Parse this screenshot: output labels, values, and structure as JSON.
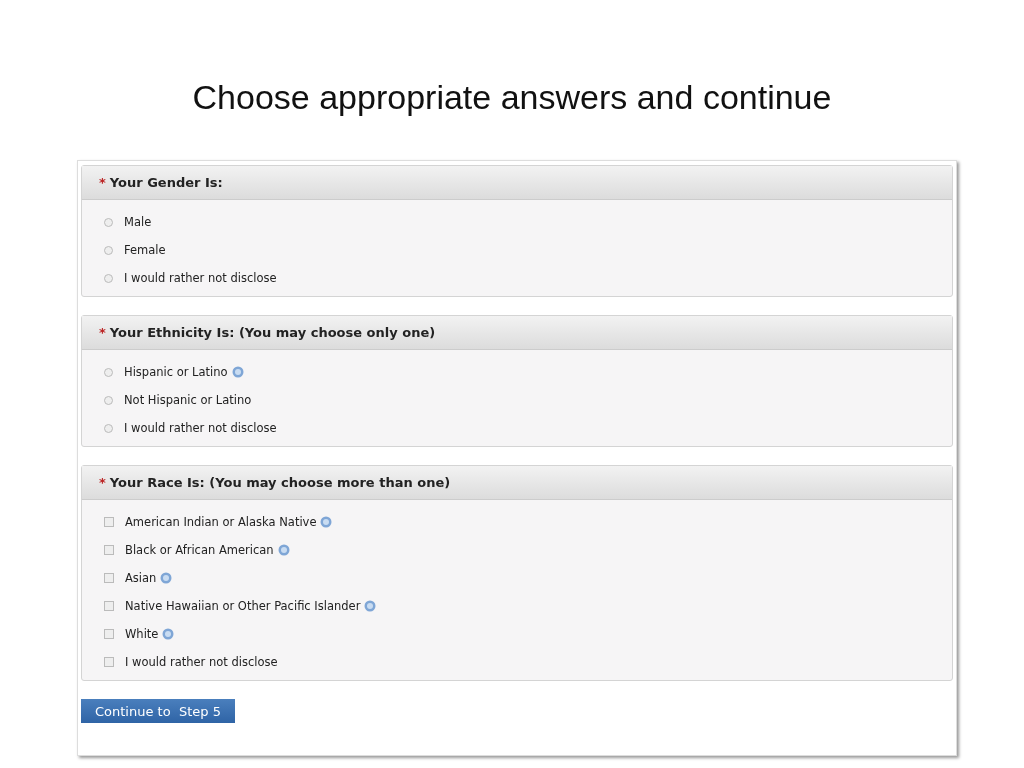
{
  "slide_title": "Choose appropriate answers and continue",
  "sections": [
    {
      "marker": "*",
      "heading": "Your Gender Is:",
      "options": [
        {
          "kind": "radio",
          "label": "Male",
          "selected": false,
          "info": false
        },
        {
          "kind": "radio",
          "label": "Female",
          "selected": false,
          "info": false
        },
        {
          "kind": "radio",
          "label": "I would rather not disclose",
          "selected": false,
          "info": false
        }
      ]
    },
    {
      "marker": "*",
      "heading": "Your Ethnicity Is: (You may choose only one)",
      "options": [
        {
          "kind": "radio",
          "label": "Hispanic or Latino",
          "selected": false,
          "info": true
        },
        {
          "kind": "radio",
          "label": "Not Hispanic or Latino",
          "selected": false,
          "info": false
        },
        {
          "kind": "radio",
          "label": "I would rather not disclose",
          "selected": false,
          "info": false
        }
      ]
    },
    {
      "marker": "*",
      "heading": "Your Race Is: (You may choose more than one)",
      "options": [
        {
          "kind": "checkbox",
          "label": "American Indian or Alaska Native",
          "selected": false,
          "info": true
        },
        {
          "kind": "checkbox",
          "label": "Black or African American",
          "selected": false,
          "info": true
        },
        {
          "kind": "checkbox",
          "label": "Asian",
          "selected": false,
          "info": true
        },
        {
          "kind": "checkbox",
          "label": "Native Hawaiian or Other Pacific Islander",
          "selected": false,
          "info": true
        },
        {
          "kind": "checkbox",
          "label": "White",
          "selected": false,
          "info": true
        },
        {
          "kind": "checkbox",
          "label": "I would rather not disclose",
          "selected": false,
          "info": false
        }
      ]
    }
  ],
  "button": "Continue to  Step 5"
}
